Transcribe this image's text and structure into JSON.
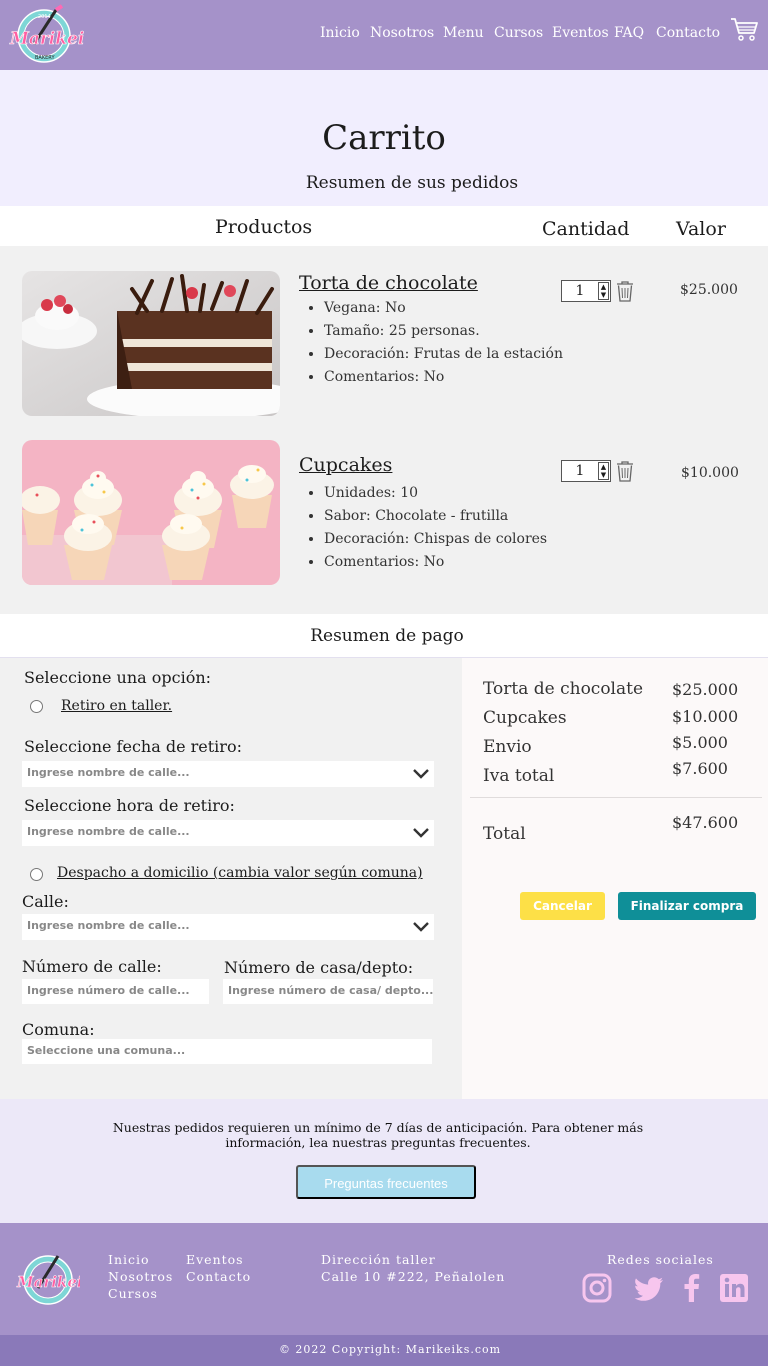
{
  "header": {
    "brand": "Marikeiks",
    "brand_year": "2014",
    "brand_sub": "BAKERY",
    "nav": [
      "Inicio",
      "Nosotros",
      "Menu",
      "Cursos",
      "Eventos",
      "FAQ",
      "Contacto"
    ]
  },
  "page": {
    "title": "Carrito",
    "subtitle": "Resumen de sus pedidos"
  },
  "products_table": {
    "col_products": "Productos",
    "col_quantity": "Cantidad",
    "col_value": "Valor",
    "items": [
      {
        "name": "Torta de chocolate",
        "details": [
          "Vegana: No",
          "Tamaño: 25 personas.",
          "Decoración: Frutas de la estación",
          "Comentarios: No"
        ],
        "quantity": "1",
        "price": "$25.000"
      },
      {
        "name": "Cupcakes",
        "details": [
          "Unidades: 10",
          "Sabor: Chocolate - frutilla",
          "Decoración: Chispas de colores",
          "Comentarios: No"
        ],
        "quantity": "1",
        "price": "$10.000"
      }
    ]
  },
  "payment": {
    "header": "Resumen de pago",
    "select_option": "Seleccione una opción:",
    "pickup_option": "Retiro en taller.",
    "date_label": "Seleccione fecha de retiro:",
    "date_placeholder": "Ingrese nombre de calle...",
    "time_label": "Seleccione hora de retiro:",
    "time_placeholder": "Ingrese nombre de calle...",
    "delivery_option": "Despacho a domicilio (cambia valor según comuna)",
    "street_label": "Calle:",
    "street_placeholder": "Ingrese nombre de calle...",
    "street_number_label": "Número de calle:",
    "street_number_placeholder": "Ingrese número de calle...",
    "house_number_label": "Número de casa/depto:",
    "house_number_placeholder": "Ingrese número de casa/ depto...",
    "commune_label": "Comuna:",
    "commune_placeholder": "Seleccione una comuna..."
  },
  "summary": {
    "rows": [
      {
        "label": "Torta de chocolate",
        "value": "$25.000"
      },
      {
        "label": "Cupcakes",
        "value": "$10.000"
      },
      {
        "label": "Envio",
        "value": "$5.000"
      },
      {
        "label": "Iva total",
        "value": "$7.600"
      }
    ],
    "total_label": "Total",
    "total_value": "$47.600",
    "cancel_label": "Cancelar",
    "finish_label": "Finalizar compra"
  },
  "notice": {
    "text": "Nuestras pedidos requieren un mínimo de 7 días de anticipación. Para obtener más información, lea nuestras preguntas frecuentes.",
    "faq_button": "Preguntas frecuentes"
  },
  "footer": {
    "links": [
      "Inicio",
      "Nosotros",
      "Cursos",
      "Eventos",
      "Contacto"
    ],
    "address_title": "Dirección taller",
    "address": "Calle 10 #222, Peñalolen",
    "social_title": "Redes sociales",
    "social_icons": [
      "instagram-icon",
      "twitter-icon",
      "facebook-icon",
      "linkedin-icon"
    ],
    "copyright": "© 2022 Copyright: Marikeiks.com"
  },
  "colors": {
    "header_bg": "#a592c9",
    "cancel_bg": "#fde047",
    "finish_bg": "#0f8f98",
    "faq_bg": "#a8dbee"
  }
}
